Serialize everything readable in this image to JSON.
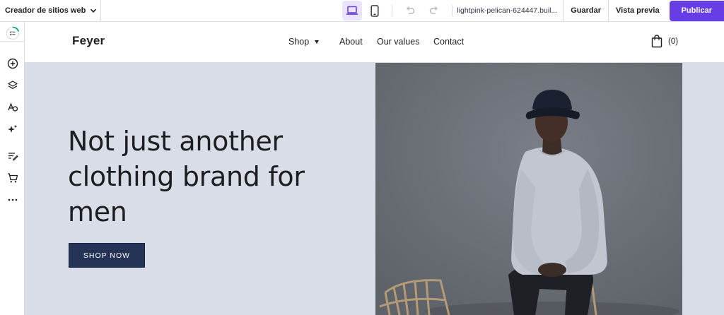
{
  "toolbar": {
    "builder_label": "Creador de sitios web",
    "url": "lightpink-pelican-624447.buil...",
    "save_label": "Guardar",
    "preview_label": "Vista previa",
    "publish_label": "Publicar",
    "active_device": "desktop",
    "accent_color": "#673de6"
  },
  "sidebar": {
    "items": [
      {
        "icon": "checklist-progress-icon"
      },
      {
        "icon": "add-element-icon"
      },
      {
        "icon": "layers-icon"
      },
      {
        "icon": "styles-icon"
      },
      {
        "icon": "ai-tools-icon"
      },
      {
        "icon": "blog-icon"
      },
      {
        "icon": "store-cart-icon"
      },
      {
        "icon": "more-icon"
      }
    ]
  },
  "site": {
    "logo": "Feyer",
    "nav": [
      {
        "label": "Shop",
        "has_dropdown": true
      },
      {
        "label": "About"
      },
      {
        "label": "Our values"
      },
      {
        "label": "Contact"
      }
    ],
    "cart_count": "(0)",
    "hero": {
      "title": "Not just another clothing brand for men",
      "cta_label": "SHOP NOW",
      "background_color": "#d8dde7",
      "cta_color": "#253456"
    }
  }
}
